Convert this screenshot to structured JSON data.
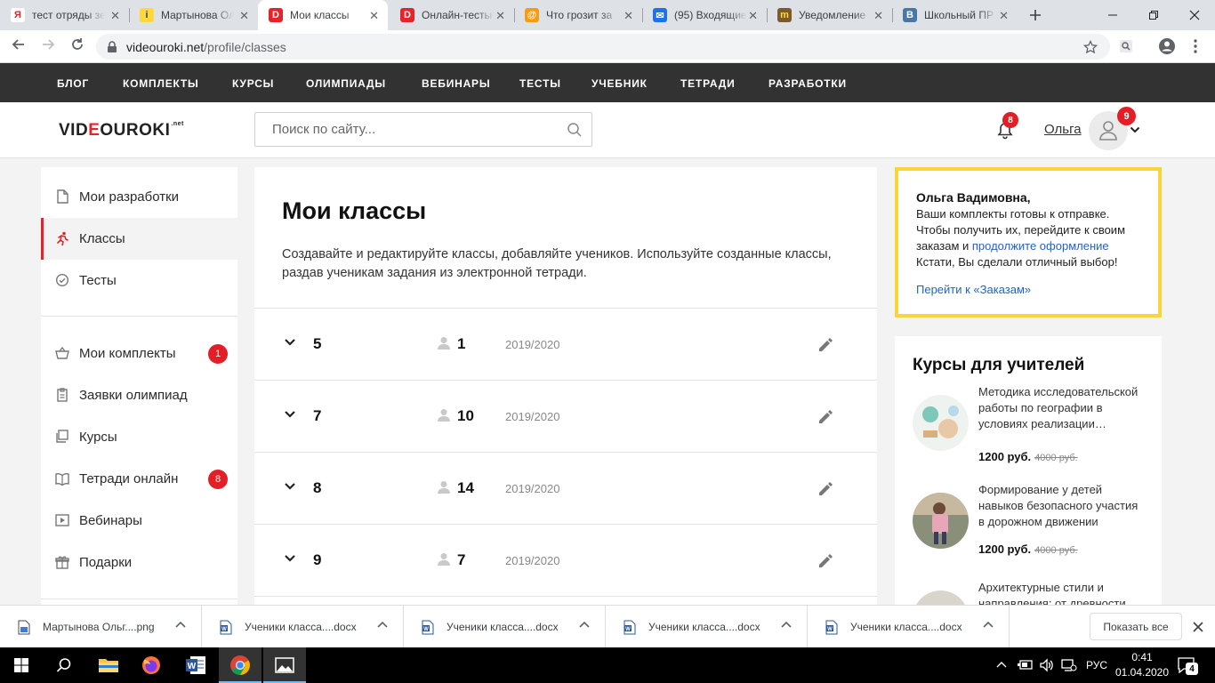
{
  "browser": {
    "tabs": [
      {
        "title": "тест отряды зе",
        "favicon": "yandex-icon",
        "color": "#ffffff",
        "fg": "#e5232a",
        "glyph": "Я"
      },
      {
        "title": "Мартынова Ол",
        "favicon": "doc-icon",
        "color": "#ffd83c",
        "fg": "#444",
        "glyph": "i"
      },
      {
        "title": "Мои классы",
        "favicon": "videouroki-icon",
        "color": "#e5232a",
        "fg": "#fff",
        "glyph": "D",
        "active": true
      },
      {
        "title": "Онлайн-тесты",
        "favicon": "videouroki-icon",
        "color": "#e5232a",
        "fg": "#fff",
        "glyph": "D"
      },
      {
        "title": "Что грозит за",
        "favicon": "mailru-icon",
        "color": "#f89c0e",
        "fg": "#fff",
        "glyph": "@"
      },
      {
        "title": "(95) Входящие",
        "favicon": "mail-icon",
        "color": "#1a73e8",
        "fg": "#fff",
        "glyph": "✉"
      },
      {
        "title": "Уведомление",
        "favicon": "edu-icon",
        "color": "#7b5b2c",
        "fg": "#ffd83c",
        "glyph": "m"
      },
      {
        "title": "Школьный ПР",
        "favicon": "vk-icon",
        "color": "#4a76a8",
        "fg": "#fff",
        "glyph": "В"
      }
    ],
    "url_domain": "videouroki.net",
    "url_path": "/profile/classes"
  },
  "site_nav": [
    "БЛОГ",
    "КОМПЛЕКТЫ",
    "КУРСЫ",
    "ОЛИМПИАДЫ",
    "ВЕБИНАРЫ",
    "ТЕСТЫ",
    "УЧЕБНИК",
    "ТЕТРАДИ",
    "РАЗРАБОТКИ"
  ],
  "header": {
    "logo_pre": "VID",
    "logo_o": "E",
    "logo_post": "OUROKI",
    "logo_sup": ".net",
    "search_placeholder": "Поиск по сайту...",
    "notif_count": "8",
    "user_name": "Ольга",
    "user_badge": "9"
  },
  "sidebar": {
    "group1": [
      {
        "label": "Мои разработки",
        "icon": "document-icon"
      },
      {
        "label": "Классы",
        "icon": "running-person-icon",
        "active": true
      },
      {
        "label": "Тесты",
        "icon": "check-circle-icon"
      }
    ],
    "group2": [
      {
        "label": "Мои комплекты",
        "icon": "basket-icon",
        "count": "1"
      },
      {
        "label": "Заявки олимпиад",
        "icon": "clipboard-icon"
      },
      {
        "label": "Курсы",
        "icon": "copy-icon"
      },
      {
        "label": "Тетради онлайн",
        "icon": "book-icon",
        "count": "8"
      },
      {
        "label": "Вебинары",
        "icon": "play-icon"
      },
      {
        "label": "Подарки",
        "icon": "gift-icon"
      }
    ]
  },
  "main": {
    "title": "Мои классы",
    "description": "Создавайте и редактируйте классы, добавляйте учеников. Используйте созданные классы, раздав ученикам задания из электронной тетради.",
    "classes": [
      {
        "name": "5",
        "students": "1",
        "year": "2019/2020"
      },
      {
        "name": "7",
        "students": "10",
        "year": "2019/2020"
      },
      {
        "name": "8",
        "students": "14",
        "year": "2019/2020"
      },
      {
        "name": "9",
        "students": "7",
        "year": "2019/2020"
      }
    ]
  },
  "promo": {
    "name": "Ольга Вадимовна,",
    "text1": "Ваши комплекты готовы к отправке. Чтобы получить их, перейдите к своим заказам и ",
    "link1": "продолжите оформление",
    "text2": "Кстати, Вы сделали отличный выбор!",
    "link2": "Перейти к «Заказам»"
  },
  "courses": {
    "title": "Курсы для учителей",
    "items": [
      {
        "title": "Методика исследовательской работы по географии в условиях реализации…",
        "price": "1200 руб.",
        "old_price": "4000 руб."
      },
      {
        "title": "Формирование у детей навыков безопасного участия в дорожном движении",
        "price": "1200 руб.",
        "old_price": "4000 руб."
      },
      {
        "title": "Архитектурные стили и направления: от древности",
        "price": "",
        "old_price": ""
      }
    ]
  },
  "downloads": {
    "files": [
      {
        "name": "Мартынова Ольг....png",
        "type": "image"
      },
      {
        "name": "Ученики  класса....docx",
        "type": "word"
      },
      {
        "name": "Ученики  класса....docx",
        "type": "word"
      },
      {
        "name": "Ученики  класса....docx",
        "type": "word"
      },
      {
        "name": "Ученики  класса....docx",
        "type": "word"
      }
    ],
    "show_all": "Показать все"
  },
  "taskbar": {
    "lang": "РУС",
    "time": "0:41",
    "date": "01.04.2020",
    "notif_count": "4"
  }
}
